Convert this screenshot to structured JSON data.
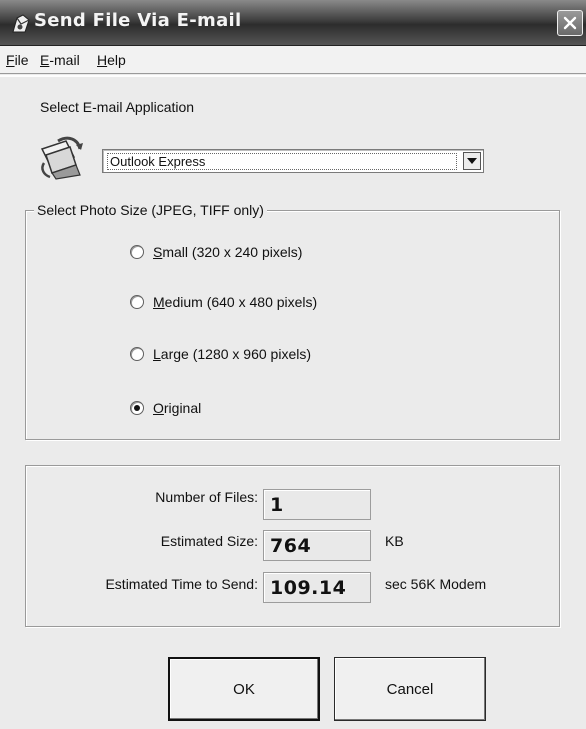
{
  "window": {
    "title": "Send File Via E-mail"
  },
  "menu": {
    "items": [
      {
        "label": "File",
        "accel": "F",
        "rest": "ile"
      },
      {
        "label": "E-mail",
        "accel": "E",
        "rest": "-mail"
      },
      {
        "label": "Help",
        "accel": "H",
        "rest": "elp"
      }
    ]
  },
  "email_app": {
    "label": "Select E-mail Application",
    "selected": "Outlook Express",
    "icon": "email-app-icon"
  },
  "photo_size": {
    "legend": "Select Photo Size (JPEG, TIFF only)",
    "options": [
      {
        "accel": "S",
        "rest": "mall (320 x 240 pixels)",
        "label": "Small (320 x 240 pixels)",
        "selected": false
      },
      {
        "accel": "M",
        "rest": "edium (640 x 480 pixels)",
        "label": "Medium (640 x 480 pixels)",
        "selected": false
      },
      {
        "accel": "L",
        "rest": "arge (1280 x 960 pixels)",
        "label": "Large (1280 x 960 pixels)",
        "selected": false
      },
      {
        "accel": "O",
        "rest": "riginal",
        "label": "Original",
        "selected": true
      }
    ]
  },
  "stats": {
    "num_files_label": "Number of Files:",
    "num_files": "1",
    "est_size_label": "Estimated Size:",
    "est_size": "764",
    "est_size_unit": "KB",
    "est_time_label": "Estimated Time to Send:",
    "est_time": "109.14",
    "est_time_unit": "sec 56K Modem"
  },
  "buttons": {
    "ok": "OK",
    "cancel": "Cancel"
  }
}
